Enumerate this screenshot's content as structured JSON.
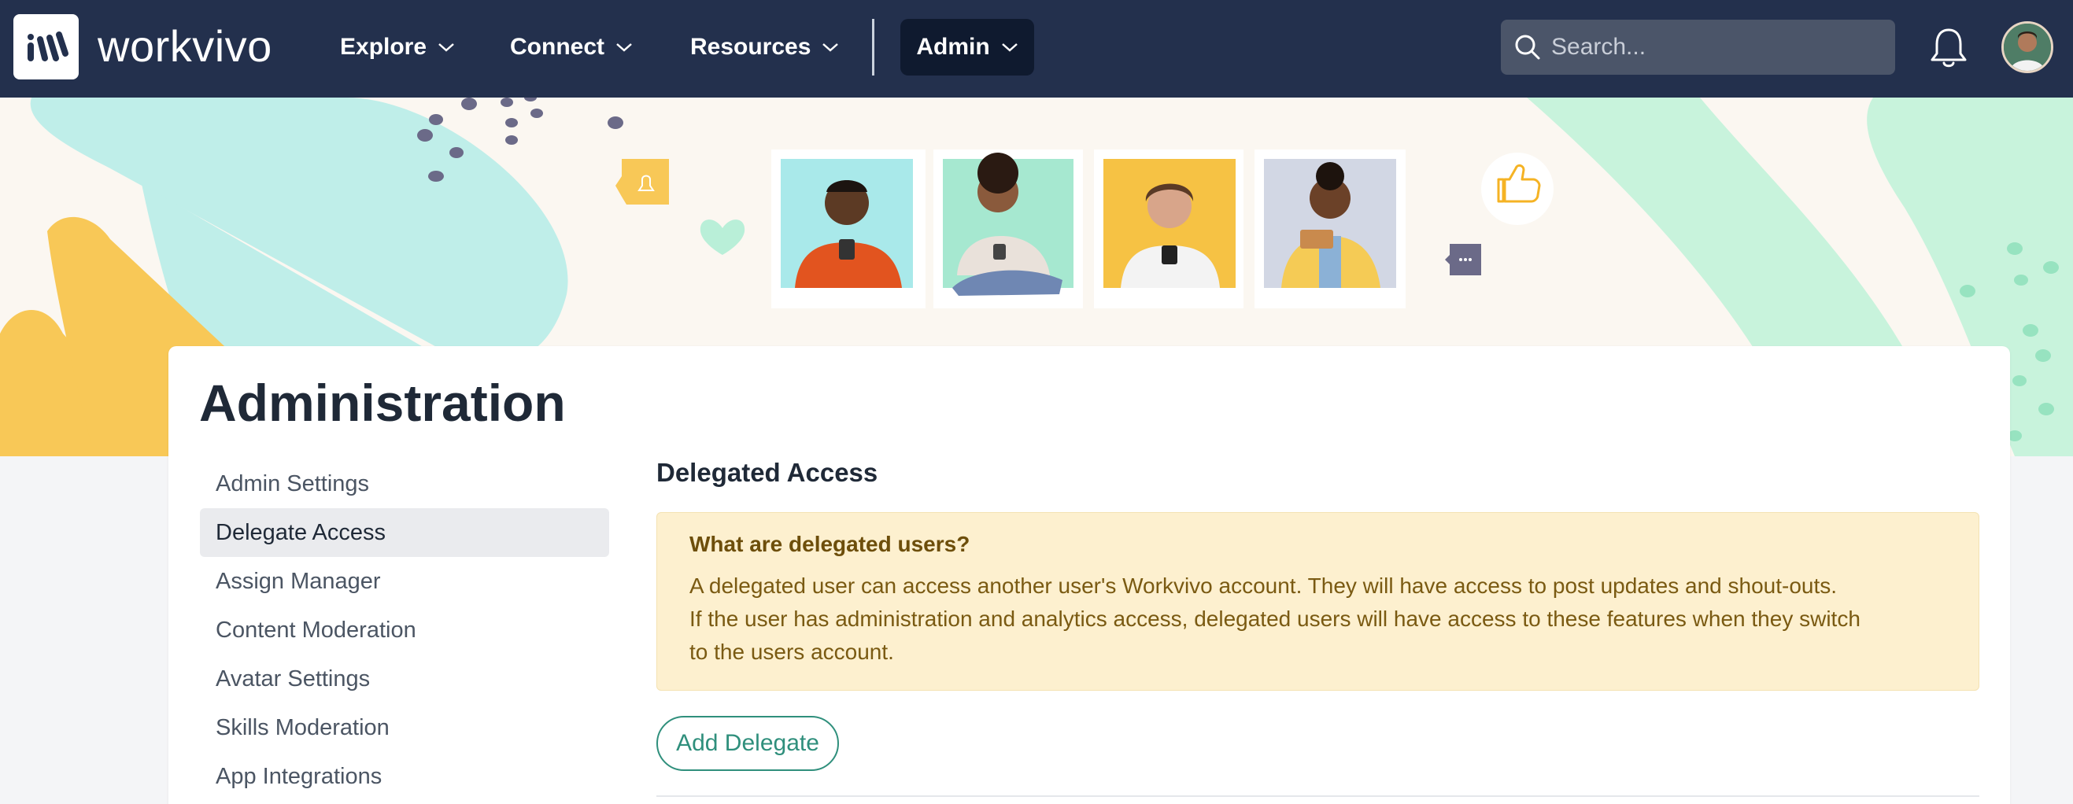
{
  "brand": {
    "name": "workvivo"
  },
  "nav": {
    "items": [
      {
        "label": "Explore"
      },
      {
        "label": "Connect"
      },
      {
        "label": "Resources"
      }
    ],
    "admin_label": "Admin",
    "search_placeholder": "Search..."
  },
  "page": {
    "title": "Administration"
  },
  "sidebar": {
    "items": [
      {
        "label": "Admin Settings",
        "active": false
      },
      {
        "label": "Delegate Access",
        "active": true
      },
      {
        "label": "Assign Manager",
        "active": false
      },
      {
        "label": "Content Moderation",
        "active": false
      },
      {
        "label": "Avatar Settings",
        "active": false
      },
      {
        "label": "Skills Moderation",
        "active": false
      },
      {
        "label": "App Integrations",
        "active": false
      }
    ]
  },
  "main": {
    "section_title": "Delegated Access",
    "info": {
      "title": "What are delegated users?",
      "lines": [
        "A delegated user can access another user's Workvivo account. They will have access to post updates and shout-outs.",
        "If the user has administration and analytics access, delegated users will have access to these features when they switch",
        "to the users account."
      ]
    },
    "add_button": "Add Delegate"
  },
  "colors": {
    "nav_bg": "#23304d",
    "admin_bg": "#0f1a2f",
    "accent": "#2f8f7c",
    "info_bg": "#fdf0cf",
    "info_text": "#7a5a12",
    "banner_teal": "#bfeee9",
    "banner_yellow": "#f8c857",
    "banner_mint": "#c8f3dc"
  }
}
